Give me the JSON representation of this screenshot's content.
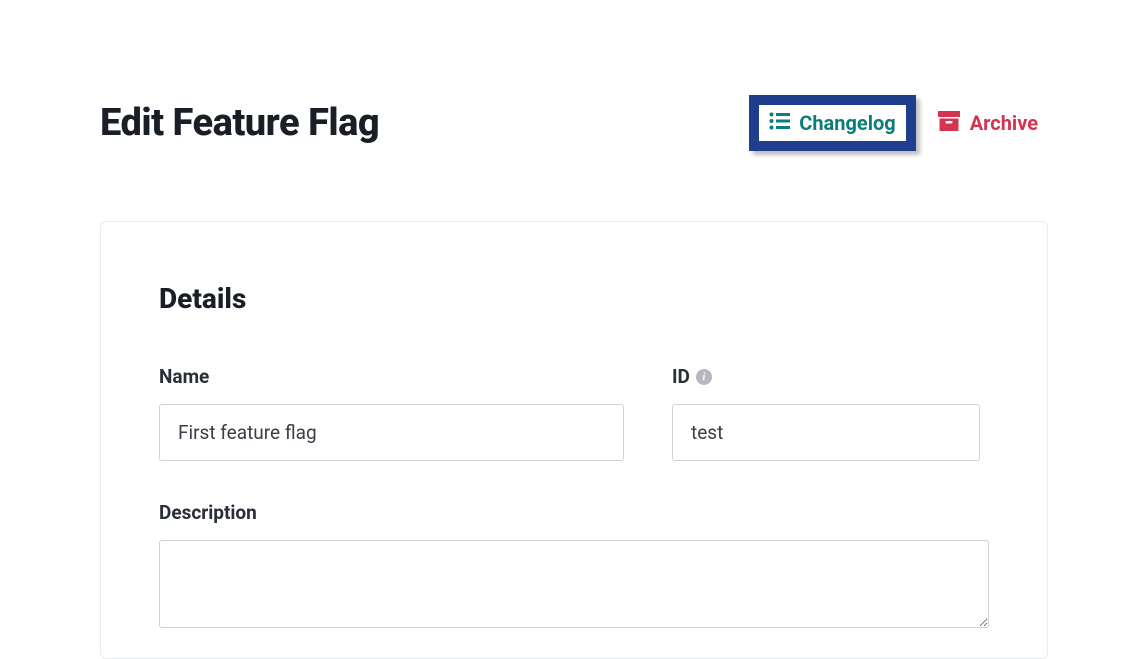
{
  "header": {
    "title": "Edit Feature Flag",
    "changelog_label": "Changelog",
    "archive_label": "Archive"
  },
  "details": {
    "section_title": "Details",
    "name_label": "Name",
    "name_value": "First feature flag",
    "id_label": "ID",
    "id_value": "test",
    "description_label": "Description",
    "description_value": ""
  }
}
